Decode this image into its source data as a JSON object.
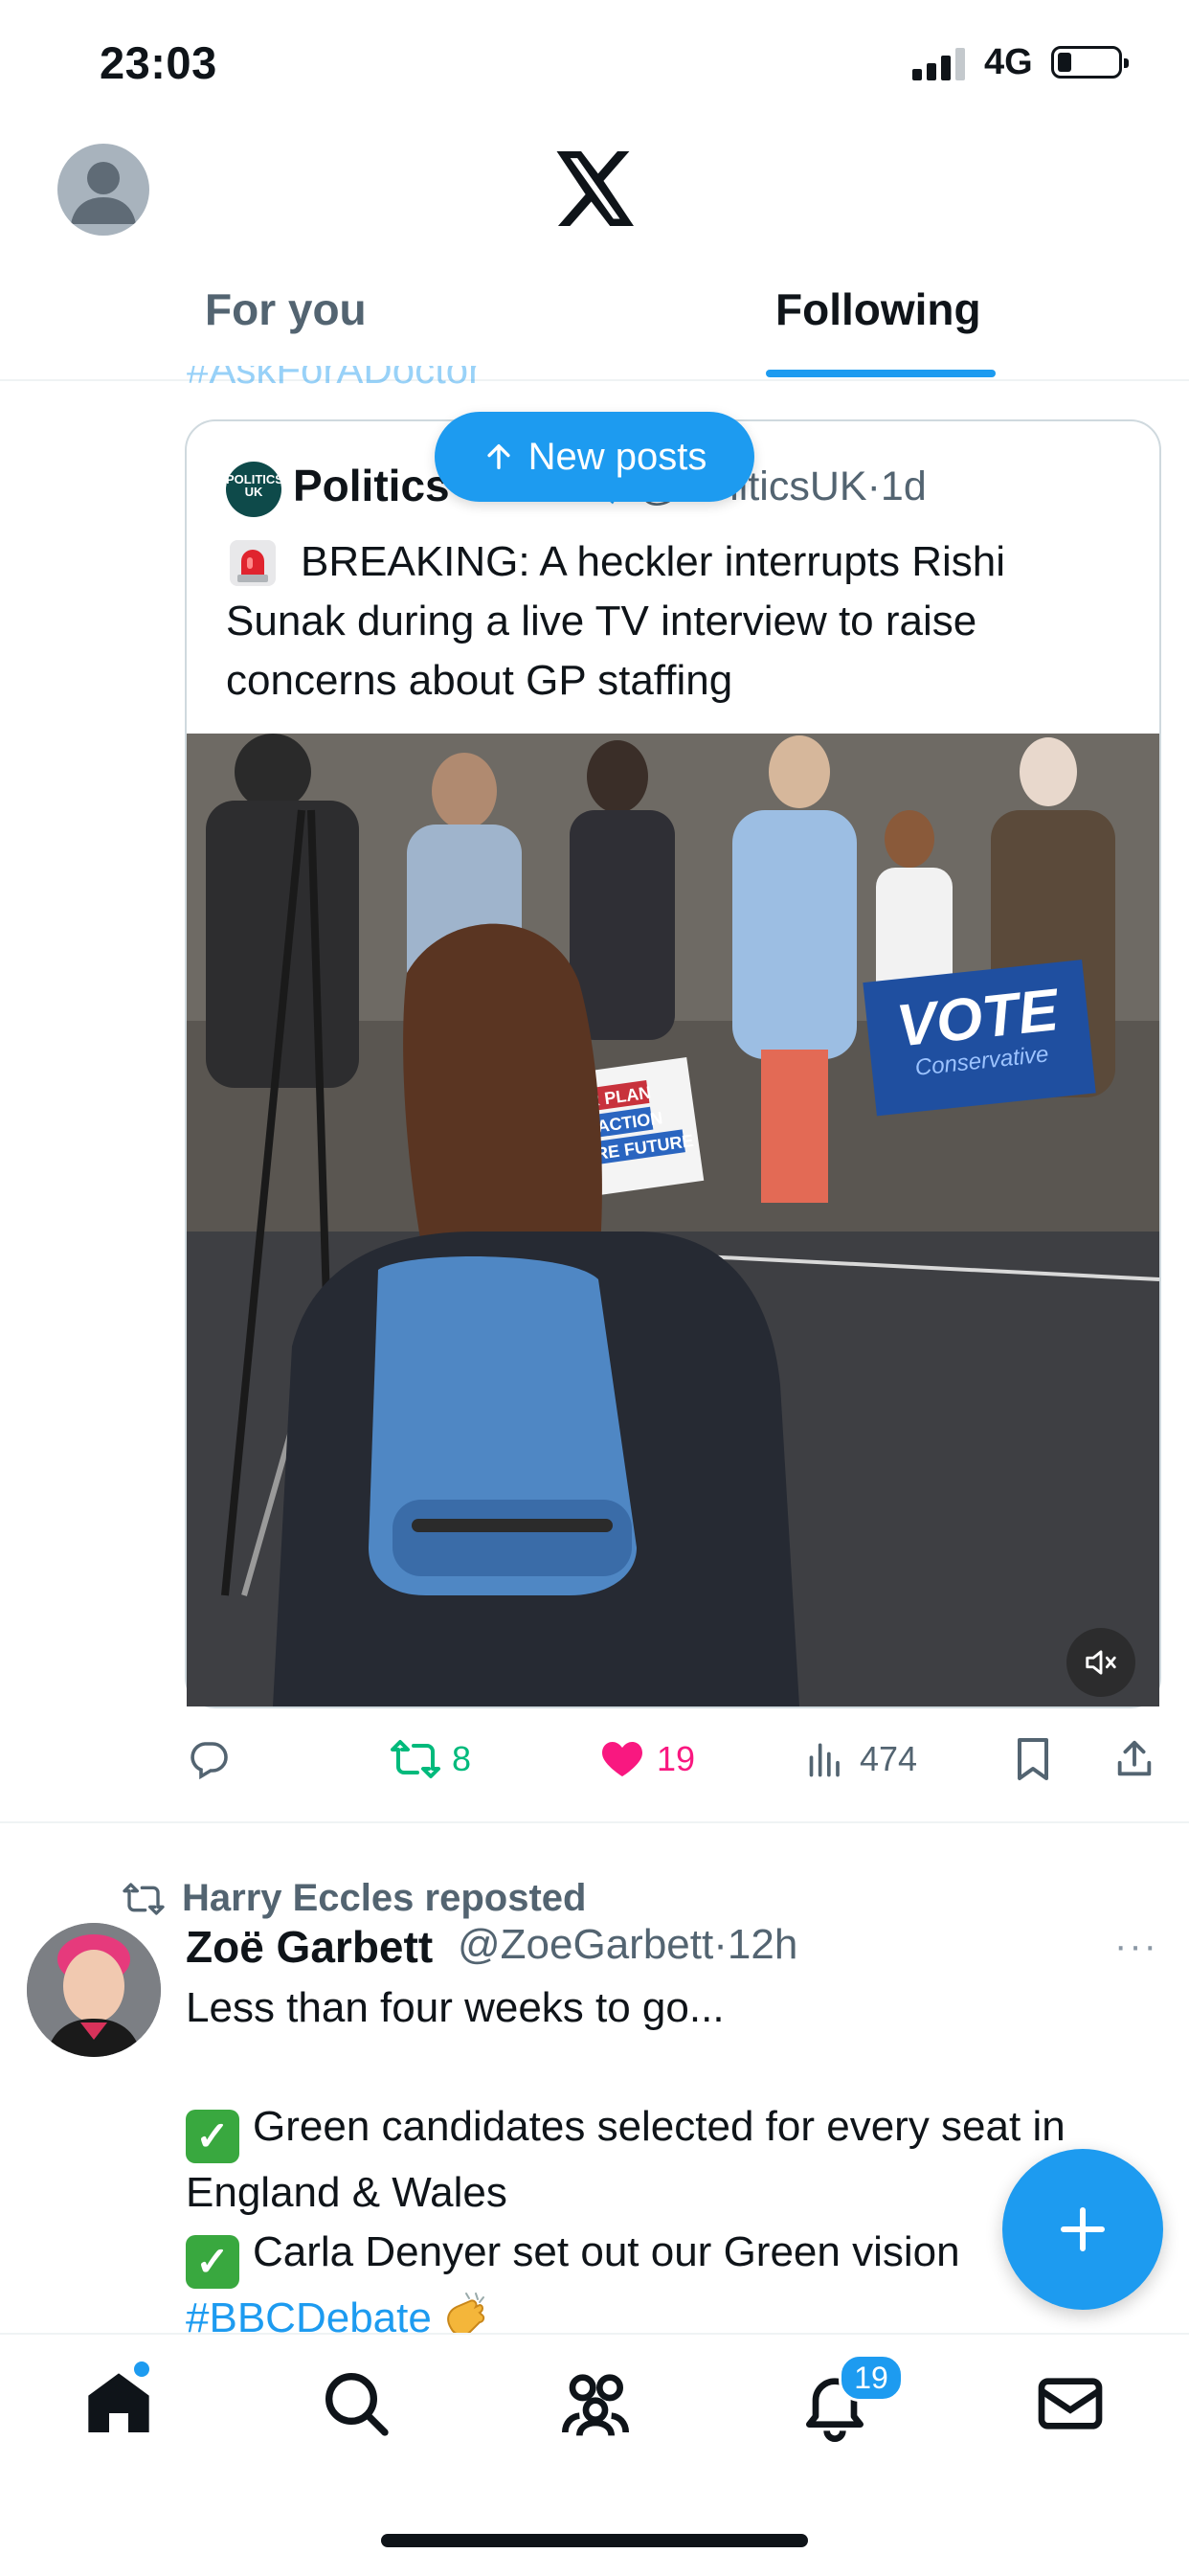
{
  "status_bar": {
    "time": "23:03",
    "network": "4G"
  },
  "tabs": [
    {
      "label": "For you"
    },
    {
      "label": "Following"
    }
  ],
  "peek_text": "#AskForADoctor",
  "new_posts_label": "New posts",
  "quoted_post": {
    "author": "Politics UK",
    "logo_text": "POLITICS UK",
    "handle": "@PoliticsUK",
    "separator": "·",
    "time": "1d",
    "text": "BREAKING: A heckler interrupts Rishi Sunak during a live TV interview to raise concerns about GP staffing",
    "media_signs": {
      "vote_main": "VOTE",
      "vote_sub": "Conservative",
      "clear_plan_1": "CLEAR PLAN",
      "clear_plan_2": "BOLD ACTION",
      "clear_plan_3": "SECURE FUTURE"
    }
  },
  "actions": {
    "reposts": "8",
    "likes": "19",
    "views": "474"
  },
  "second_post": {
    "reposted_by": "Harry Eccles reposted",
    "author": "Zoë Garbett",
    "handle": "@ZoeGarbett",
    "separator": "·",
    "time": "12h",
    "more": "···",
    "line1": "Less than four weeks to go...",
    "line2": "Green candidates selected for every seat in England & Wales",
    "line3": "Carla Denyer set out our Green vision",
    "hashtag": "#BBCDebate"
  },
  "notifications_badge": "19",
  "colors": {
    "accent": "#1d9bf0",
    "like": "#f91880",
    "repost": "#00ba7c",
    "text": "#0f1419",
    "muted": "#536471"
  }
}
